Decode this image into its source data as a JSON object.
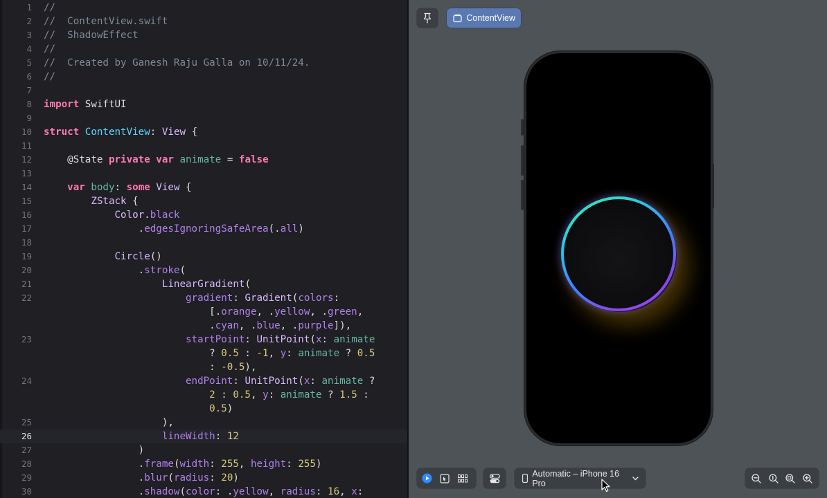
{
  "editor": {
    "current_line": 26,
    "lines": [
      {
        "n": "1",
        "tokens": [
          [
            "c",
            "//"
          ]
        ]
      },
      {
        "n": "2",
        "tokens": [
          [
            "c",
            "//  ContentView.swift"
          ]
        ]
      },
      {
        "n": "3",
        "tokens": [
          [
            "c",
            "//  ShadowEffect"
          ]
        ]
      },
      {
        "n": "4",
        "tokens": [
          [
            "c",
            "//"
          ]
        ]
      },
      {
        "n": "5",
        "tokens": [
          [
            "c",
            "//  Created by Ganesh Raju Galla on 10/11/24."
          ]
        ]
      },
      {
        "n": "6",
        "tokens": [
          [
            "c",
            "//"
          ]
        ]
      },
      {
        "n": "7",
        "tokens": []
      },
      {
        "n": "8",
        "tokens": [
          [
            "k",
            "import"
          ],
          [
            "p",
            " SwiftUI"
          ]
        ]
      },
      {
        "n": "9",
        "tokens": []
      },
      {
        "n": "10",
        "tokens": [
          [
            "k",
            "struct"
          ],
          [
            "p",
            " "
          ],
          [
            "d",
            "ContentView"
          ],
          [
            "p",
            ": "
          ],
          [
            "t",
            "View"
          ],
          [
            "p",
            " {"
          ]
        ]
      },
      {
        "n": "11",
        "tokens": []
      },
      {
        "n": "12",
        "tokens": [
          [
            "p",
            "    @State "
          ],
          [
            "k",
            "private var"
          ],
          [
            "p",
            " "
          ],
          [
            "i",
            "animate"
          ],
          [
            "p",
            " = "
          ],
          [
            "k",
            "false"
          ]
        ]
      },
      {
        "n": "13",
        "tokens": []
      },
      {
        "n": "14",
        "tokens": [
          [
            "p",
            "    "
          ],
          [
            "k",
            "var"
          ],
          [
            "p",
            " "
          ],
          [
            "i",
            "body"
          ],
          [
            "p",
            ": "
          ],
          [
            "k",
            "some"
          ],
          [
            "p",
            " "
          ],
          [
            "t",
            "View"
          ],
          [
            "p",
            " {"
          ]
        ]
      },
      {
        "n": "15",
        "tokens": [
          [
            "p",
            "        "
          ],
          [
            "t",
            "ZStack"
          ],
          [
            "p",
            " {"
          ]
        ]
      },
      {
        "n": "16",
        "tokens": [
          [
            "p",
            "            "
          ],
          [
            "t",
            "Color"
          ],
          [
            "p",
            "."
          ],
          [
            "o",
            "black"
          ]
        ]
      },
      {
        "n": "17",
        "tokens": [
          [
            "p",
            "                ."
          ],
          [
            "o",
            "edgesIgnoringSafeArea"
          ],
          [
            "p",
            "(."
          ],
          [
            "o",
            "all"
          ],
          [
            "p",
            ")"
          ]
        ]
      },
      {
        "n": "18",
        "tokens": []
      },
      {
        "n": "19",
        "tokens": [
          [
            "p",
            "            "
          ],
          [
            "t",
            "Circle"
          ],
          [
            "p",
            "()"
          ]
        ]
      },
      {
        "n": "20",
        "tokens": [
          [
            "p",
            "                ."
          ],
          [
            "o",
            "stroke"
          ],
          [
            "p",
            "("
          ]
        ]
      },
      {
        "n": "21",
        "tokens": [
          [
            "p",
            "                    "
          ],
          [
            "t",
            "LinearGradient"
          ],
          [
            "p",
            "("
          ]
        ]
      },
      {
        "n": "22",
        "tokens": [
          [
            "p",
            "                        "
          ],
          [
            "o",
            "gradient"
          ],
          [
            "p",
            ": "
          ],
          [
            "t",
            "Gradient"
          ],
          [
            "p",
            "("
          ],
          [
            "o",
            "colors"
          ],
          [
            "p",
            ":"
          ]
        ]
      },
      {
        "n": "",
        "tokens": [
          [
            "p",
            "                            [."
          ],
          [
            "o",
            "orange"
          ],
          [
            "p",
            ", ."
          ],
          [
            "o",
            "yellow"
          ],
          [
            "p",
            ", ."
          ],
          [
            "o",
            "green"
          ],
          [
            "p",
            ","
          ]
        ]
      },
      {
        "n": "",
        "tokens": [
          [
            "p",
            "                            ."
          ],
          [
            "o",
            "cyan"
          ],
          [
            "p",
            ", ."
          ],
          [
            "o",
            "blue"
          ],
          [
            "p",
            ", ."
          ],
          [
            "o",
            "purple"
          ],
          [
            "p",
            "]),"
          ]
        ]
      },
      {
        "n": "23",
        "tokens": [
          [
            "p",
            "                        "
          ],
          [
            "o",
            "startPoint"
          ],
          [
            "p",
            ": "
          ],
          [
            "t",
            "UnitPoint"
          ],
          [
            "p",
            "("
          ],
          [
            "o",
            "x"
          ],
          [
            "p",
            ": "
          ],
          [
            "i",
            "animate"
          ]
        ]
      },
      {
        "n": "",
        "tokens": [
          [
            "p",
            "                            ? "
          ],
          [
            "n",
            "0.5"
          ],
          [
            "p",
            " : "
          ],
          [
            "n",
            "-1"
          ],
          [
            "p",
            ", "
          ],
          [
            "o",
            "y"
          ],
          [
            "p",
            ": "
          ],
          [
            "i",
            "animate"
          ],
          [
            "p",
            " ? "
          ],
          [
            "n",
            "0.5"
          ]
        ]
      },
      {
        "n": "",
        "tokens": [
          [
            "p",
            "                            : "
          ],
          [
            "n",
            "-0.5"
          ],
          [
            "p",
            "),"
          ]
        ]
      },
      {
        "n": "24",
        "tokens": [
          [
            "p",
            "                        "
          ],
          [
            "o",
            "endPoint"
          ],
          [
            "p",
            ": "
          ],
          [
            "t",
            "UnitPoint"
          ],
          [
            "p",
            "("
          ],
          [
            "o",
            "x"
          ],
          [
            "p",
            ": "
          ],
          [
            "i",
            "animate"
          ],
          [
            "p",
            " ?"
          ]
        ]
      },
      {
        "n": "",
        "tokens": [
          [
            "p",
            "                            "
          ],
          [
            "n",
            "2"
          ],
          [
            "p",
            " : "
          ],
          [
            "n",
            "0.5"
          ],
          [
            "p",
            ", "
          ],
          [
            "o",
            "y"
          ],
          [
            "p",
            ": "
          ],
          [
            "i",
            "animate"
          ],
          [
            "p",
            " ? "
          ],
          [
            "n",
            "1.5"
          ],
          [
            "p",
            " :"
          ]
        ]
      },
      {
        "n": "",
        "tokens": [
          [
            "p",
            "                            "
          ],
          [
            "n",
            "0.5"
          ],
          [
            "p",
            ")"
          ]
        ]
      },
      {
        "n": "25",
        "tokens": [
          [
            "p",
            "                    ),"
          ]
        ]
      },
      {
        "n": "26",
        "tokens": [
          [
            "p",
            "                    "
          ],
          [
            "o",
            "lineWidth"
          ],
          [
            "p",
            ": "
          ],
          [
            "n",
            "12"
          ]
        ]
      },
      {
        "n": "27",
        "tokens": [
          [
            "p",
            "                )"
          ]
        ]
      },
      {
        "n": "28",
        "tokens": [
          [
            "p",
            "                ."
          ],
          [
            "o",
            "frame"
          ],
          [
            "p",
            "("
          ],
          [
            "o",
            "width"
          ],
          [
            "p",
            ": "
          ],
          [
            "n",
            "255"
          ],
          [
            "p",
            ", "
          ],
          [
            "o",
            "height"
          ],
          [
            "p",
            ": "
          ],
          [
            "n",
            "255"
          ],
          [
            "p",
            ")"
          ]
        ]
      },
      {
        "n": "29",
        "tokens": [
          [
            "p",
            "                ."
          ],
          [
            "o",
            "blur"
          ],
          [
            "p",
            "("
          ],
          [
            "o",
            "radius"
          ],
          [
            "p",
            ": "
          ],
          [
            "n",
            "20"
          ],
          [
            "p",
            ")"
          ]
        ]
      },
      {
        "n": "30",
        "tokens": [
          [
            "p",
            "                ."
          ],
          [
            "o",
            "shadow"
          ],
          [
            "p",
            "("
          ],
          [
            "o",
            "color"
          ],
          [
            "p",
            ": ."
          ],
          [
            "o",
            "yellow"
          ],
          [
            "p",
            ", "
          ],
          [
            "o",
            "radius"
          ],
          [
            "p",
            ": "
          ],
          [
            "n",
            "16"
          ],
          [
            "p",
            ", "
          ],
          [
            "o",
            "x"
          ],
          [
            "p",
            ":"
          ]
        ]
      }
    ]
  },
  "canvas": {
    "pin_icon": "pin-icon",
    "tab_label": "ContentView",
    "tab_icon": "document-icon",
    "device_label": "Automatic – iPhone 16 Pro",
    "device_icon": "iphone-icon",
    "bottom_tools": [
      "live-mode-icon",
      "selectable-mode-icon",
      "variants-icon",
      "device-settings-icon"
    ],
    "zoom_tools": [
      "zoom-out-icon",
      "zoom-100-icon",
      "zoom-fit-icon",
      "zoom-in-icon"
    ],
    "gradient_colors": [
      "#3ff28f",
      "#2bd0e0",
      "#3a84ff",
      "#8a45f0",
      "#b14be8"
    ],
    "shadow_color": "#c88c00"
  }
}
